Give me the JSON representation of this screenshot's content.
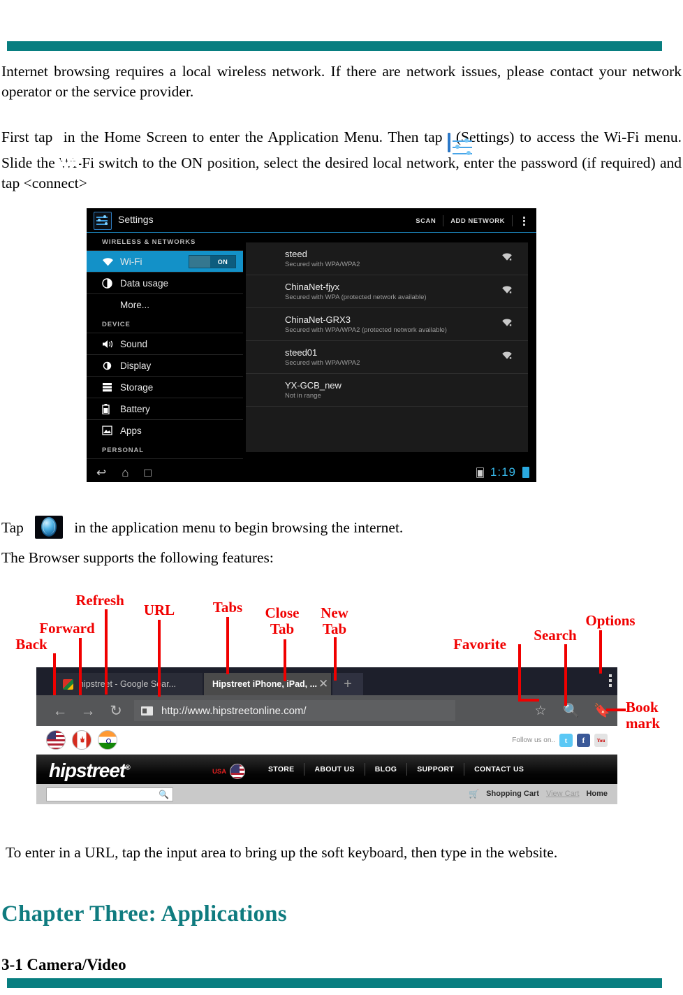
{
  "document": {
    "paragraph_1": "Internet browsing requires a local wireless network. If there are network issues, please contact your network operator or the service provider.",
    "paragraph_2_part1": "First tap",
    "paragraph_2_part2": "in the Home Screen to enter the Application Menu.   Then tap",
    "paragraph_2_part3": "(Settings) to access the Wi-Fi menu.   Slide the Wi-Fi switch to the ON position, select the desired local network, enter the password (if required) and tap <connect>",
    "tap_line_prefix": "Tap",
    "tap_line_suffix": "in the application menu to begin browsing the internet.",
    "features_line": "The Browser supports the following features:",
    "url_note": "To enter in a URL, tap the input area to bring up the soft keyboard, then type in the website.",
    "chapter_heading": "Chapter Three: Applications",
    "subheading": "3-1 Camera/Video",
    "accent_color": "#087e80",
    "annotation_color": "#f00000"
  },
  "settings_screenshot": {
    "app_title": "Settings",
    "actions": {
      "scan": "SCAN",
      "add_network": "ADD NETWORK"
    },
    "sections": [
      {
        "label": "WIRELESS & NETWORKS",
        "rows": [
          {
            "label": "Wi-Fi",
            "icon": "wifi-icon",
            "selected": true,
            "toggle": "ON"
          },
          {
            "label": "Data usage",
            "icon": "data-usage-icon",
            "selected": false
          },
          {
            "label": "More...",
            "icon": "",
            "selected": false
          }
        ]
      },
      {
        "label": "DEVICE",
        "rows": [
          {
            "label": "Sound",
            "icon": "sound-icon",
            "selected": false
          },
          {
            "label": "Display",
            "icon": "display-icon",
            "selected": false
          },
          {
            "label": "Storage",
            "icon": "storage-icon",
            "selected": false
          },
          {
            "label": "Battery",
            "icon": "battery-icon",
            "selected": false
          },
          {
            "label": "Apps",
            "icon": "apps-icon",
            "selected": false
          }
        ]
      },
      {
        "label": "PERSONAL",
        "rows": []
      }
    ],
    "networks": [
      {
        "ssid": "steed",
        "status": "Secured with WPA/WPA2"
      },
      {
        "ssid": "ChinaNet-fjyx",
        "status": "Secured with WPA (protected network available)"
      },
      {
        "ssid": "ChinaNet-GRX3",
        "status": "Secured with WPA/WPA2 (protected network available)"
      },
      {
        "ssid": "steed01",
        "status": "Secured with WPA/WPA2"
      },
      {
        "ssid": "YX-GCB_new",
        "status": "Not in range"
      }
    ],
    "statusbar": {
      "clock": "1:19"
    },
    "accent_blue": "#1391c8"
  },
  "browser_screenshot": {
    "tabs": [
      {
        "title": "hipstreet - Google Sear...",
        "active": false
      },
      {
        "title": "Hipstreet iPhone, iPad, ...",
        "active": true
      }
    ],
    "url": "http://www.hipstreetonline.com/",
    "page": {
      "follow_label": "Follow us on..",
      "logo": "hipstreet",
      "country_label": "USA",
      "nav_links": [
        "STORE",
        "ABOUT US",
        "BLOG",
        "SUPPORT",
        "CONTACT US"
      ],
      "cart": {
        "shopping_cart": "Shopping Cart",
        "view_cart": "View Cart",
        "home": "Home"
      }
    }
  },
  "annotations": [
    {
      "id": "back",
      "label": "Back"
    },
    {
      "id": "forward",
      "label": "Forward"
    },
    {
      "id": "refresh",
      "label": "Refresh"
    },
    {
      "id": "url",
      "label": "URL"
    },
    {
      "id": "tabs",
      "label": "Tabs"
    },
    {
      "id": "close-tab",
      "label": "Close\nTab"
    },
    {
      "id": "new-tab",
      "label": "New\nTab"
    },
    {
      "id": "favorite",
      "label": "Favorite"
    },
    {
      "id": "search",
      "label": "Search"
    },
    {
      "id": "options",
      "label": "Options"
    },
    {
      "id": "bookmark",
      "label": "Book\nmark"
    }
  ]
}
